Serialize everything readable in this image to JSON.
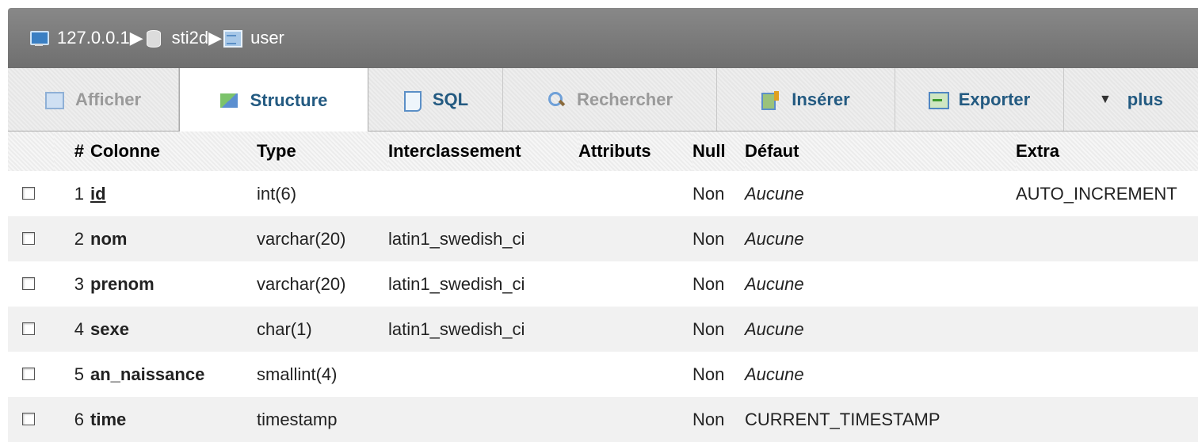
{
  "breadcrumb": {
    "server": "127.0.0.1",
    "database": "sti2d",
    "table": "user"
  },
  "tabs": [
    {
      "label": "Afficher",
      "icon": "browse-icon"
    },
    {
      "label": "Structure",
      "icon": "structure-icon"
    },
    {
      "label": "SQL",
      "icon": "sql-icon"
    },
    {
      "label": "Rechercher",
      "icon": "search-icon"
    },
    {
      "label": "Insérer",
      "icon": "insert-icon"
    },
    {
      "label": "Exporter",
      "icon": "export-icon"
    },
    {
      "label": "plus",
      "icon": "triangle-down-icon"
    }
  ],
  "columns": {
    "num": "#",
    "name": "Colonne",
    "type": "Type",
    "collation": "Interclassement",
    "attributes": "Attributs",
    "null": "Null",
    "default": "Défaut",
    "extra": "Extra"
  },
  "rows": [
    {
      "num": "1",
      "name": "id",
      "type": "int(6)",
      "collation": "",
      "attributes": "",
      "null": "Non",
      "default": "Aucune",
      "extra": "AUTO_INCREMENT"
    },
    {
      "num": "2",
      "name": "nom",
      "type": "varchar(20)",
      "collation": "latin1_swedish_ci",
      "attributes": "",
      "null": "Non",
      "default": "Aucune",
      "extra": ""
    },
    {
      "num": "3",
      "name": "prenom",
      "type": "varchar(20)",
      "collation": "latin1_swedish_ci",
      "attributes": "",
      "null": "Non",
      "default": "Aucune",
      "extra": ""
    },
    {
      "num": "4",
      "name": "sexe",
      "type": "char(1)",
      "collation": "latin1_swedish_ci",
      "attributes": "",
      "null": "Non",
      "default": "Aucune",
      "extra": ""
    },
    {
      "num": "5",
      "name": "an_naissance",
      "type": "smallint(4)",
      "collation": "",
      "attributes": "",
      "null": "Non",
      "default": "Aucune",
      "extra": ""
    },
    {
      "num": "6",
      "name": "time",
      "type": "timestamp",
      "collation": "",
      "attributes": "",
      "null": "Non",
      "default": "CURRENT_TIMESTAMP",
      "extra": ""
    }
  ]
}
